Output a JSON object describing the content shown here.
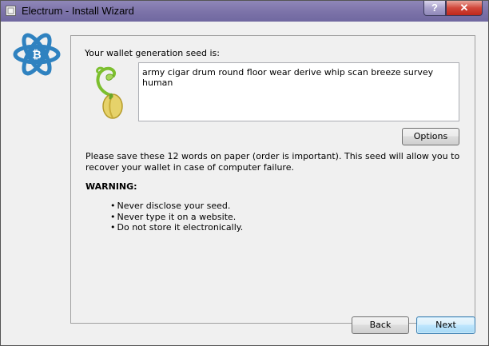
{
  "window": {
    "title": "Electrum  -  Install Wizard",
    "help_label": "?",
    "close_label": "✕"
  },
  "wizard": {
    "seed_label": "Your wallet generation seed is:",
    "seed_words": "army cigar drum round floor wear derive whip scan breeze survey human",
    "options_label": "Options",
    "info_text": "Please save these 12 words on paper (order is important). This seed will allow you to recover your wallet in case of computer failure.",
    "warning_label": "WARNING:",
    "warnings": [
      "Never disclose your seed.",
      "Never type it on a website.",
      "Do not store it electronically."
    ]
  },
  "footer": {
    "back_label": "Back",
    "next_label": "Next"
  },
  "icons": {
    "app": "electrum-atom-icon",
    "seed": "sprouting-seed-icon"
  },
  "colors": {
    "electrum_blue": "#2f82c0",
    "titlebar": "#7b72a8",
    "close_red": "#c0281c"
  }
}
